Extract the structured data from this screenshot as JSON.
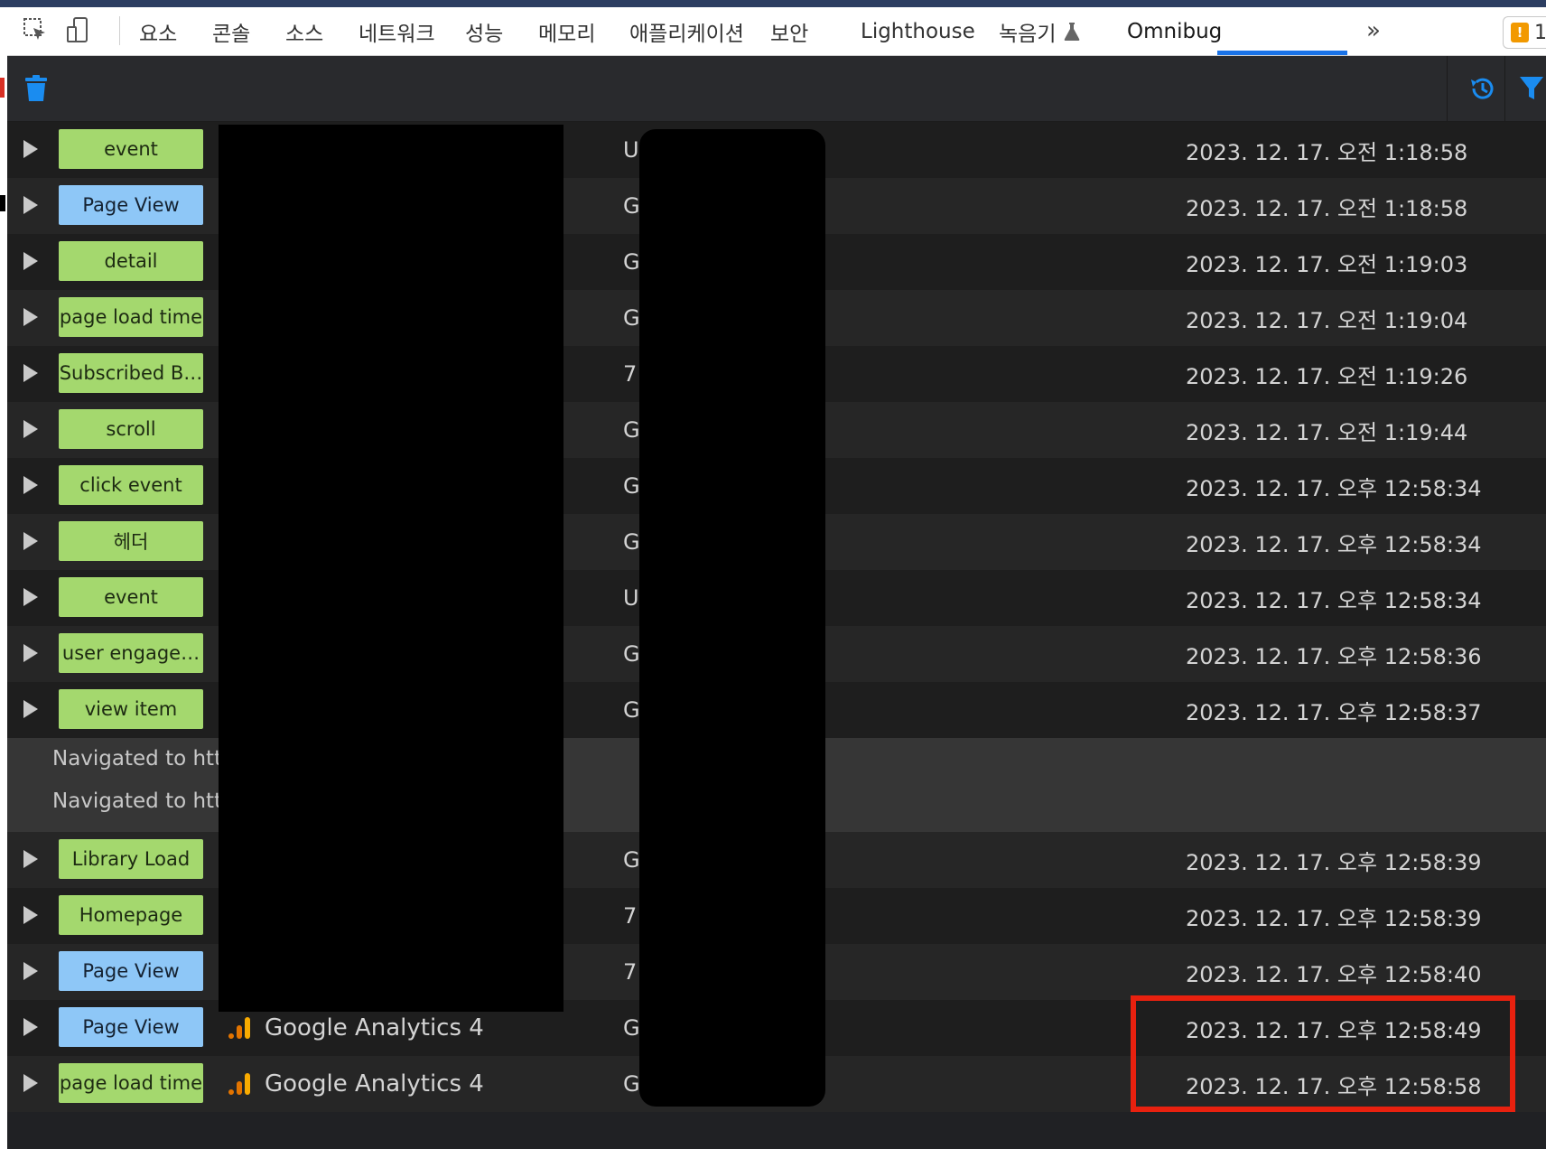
{
  "tabbar": {
    "tabs": [
      "요소",
      "콘솔",
      "소스",
      "네트워크",
      "성능",
      "메모리",
      "애플리케이션",
      "보안",
      "Lighthouse",
      "녹음기",
      "Omnibug"
    ],
    "active_tab": "Omnibug",
    "overflow_label": "»",
    "issues_count": "1"
  },
  "toolbar": {
    "clear_icon": "trash-icon",
    "history_icon": "history-icon",
    "filter_icon": "filter-icon"
  },
  "colors": {
    "badge_green": "#a4d86e",
    "badge_blue": "#8ec7f7",
    "accent": "#1a73e8",
    "highlight": "#e8210f"
  },
  "rows": [
    {
      "badge": "event",
      "badge_color": "green",
      "id": "U",
      "time": "2023. 12. 17. 오전 1:18:58"
    },
    {
      "badge": "Page View",
      "badge_color": "blue",
      "id": "G",
      "time": "2023. 12. 17. 오전 1:18:58"
    },
    {
      "badge": "detail",
      "badge_color": "green",
      "id": "G",
      "time": "2023. 12. 17. 오전 1:19:03"
    },
    {
      "badge": "page load time",
      "badge_color": "green",
      "id": "G",
      "time": "2023. 12. 17. 오전 1:19:04"
    },
    {
      "badge": "Subscribed B…",
      "badge_color": "green",
      "id": "7",
      "time": "2023. 12. 17. 오전 1:19:26"
    },
    {
      "badge": "scroll",
      "badge_color": "green",
      "id": "G",
      "time": "2023. 12. 17. 오전 1:19:44"
    },
    {
      "badge": "click event",
      "badge_color": "green",
      "id": "G",
      "time": "2023. 12. 17. 오후 12:58:34"
    },
    {
      "badge": "헤더",
      "badge_color": "green",
      "id": "G",
      "time": "2023. 12. 17. 오후 12:58:34"
    },
    {
      "badge": "event",
      "badge_color": "green",
      "id": "U",
      "time": "2023. 12. 17. 오후 12:58:34"
    },
    {
      "badge": "user engage…",
      "badge_color": "green",
      "id": "G",
      "time": "2023. 12. 17. 오후 12:58:36"
    },
    {
      "badge": "view item",
      "badge_color": "green",
      "id": "G",
      "time": "2023. 12. 17. 오후 12:58:37"
    }
  ],
  "navigation": [
    "Navigated to http",
    "Navigated to http"
  ],
  "rows_after": [
    {
      "badge": "Library Load",
      "badge_color": "green",
      "id": "G",
      "time": "2023. 12. 17. 오후 12:58:39"
    },
    {
      "badge": "Homepage",
      "badge_color": "green",
      "id": "7",
      "time": "2023. 12. 17. 오후 12:58:39"
    },
    {
      "badge": "Page View",
      "badge_color": "blue",
      "id": "7",
      "time": "2023. 12. 17. 오후 12:58:40"
    },
    {
      "badge": "Page View",
      "badge_color": "blue",
      "provider": "Google Analytics 4",
      "id": "G",
      "time": "2023. 12. 17. 오후 12:58:49"
    },
    {
      "badge": "page load time",
      "badge_color": "green",
      "provider": "Google Analytics 4",
      "id": "G",
      "time": "2023. 12. 17. 오후 12:58:58"
    }
  ]
}
